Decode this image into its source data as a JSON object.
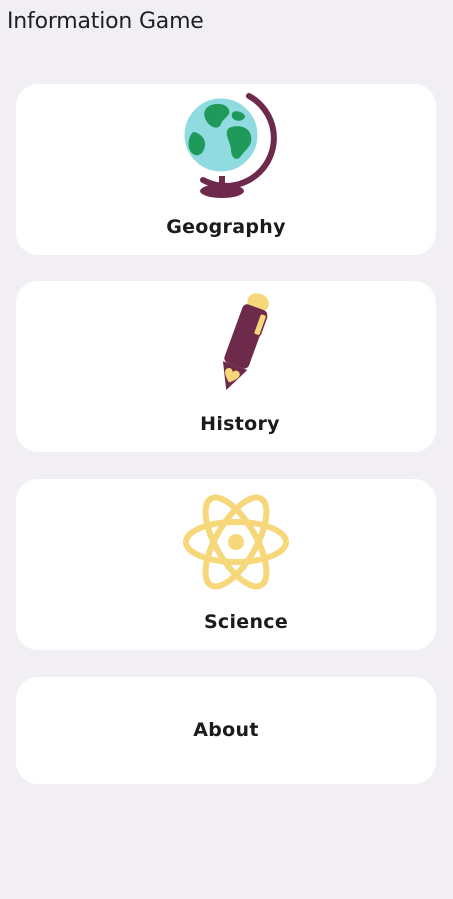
{
  "app": {
    "title": "Information Game"
  },
  "menu": {
    "items": [
      {
        "label": "Geography",
        "icon": "globe-icon"
      },
      {
        "label": "History",
        "icon": "pencil-icon"
      },
      {
        "label": "Science",
        "icon": "atom-icon"
      },
      {
        "label": "About",
        "icon": ""
      }
    ]
  },
  "colors": {
    "background": "#f1eff4",
    "card": "#ffffff",
    "plum": "#6e2a4b",
    "ocean": "#8fdbe0",
    "land": "#1f9a5a",
    "yellow": "#f6d77a"
  }
}
